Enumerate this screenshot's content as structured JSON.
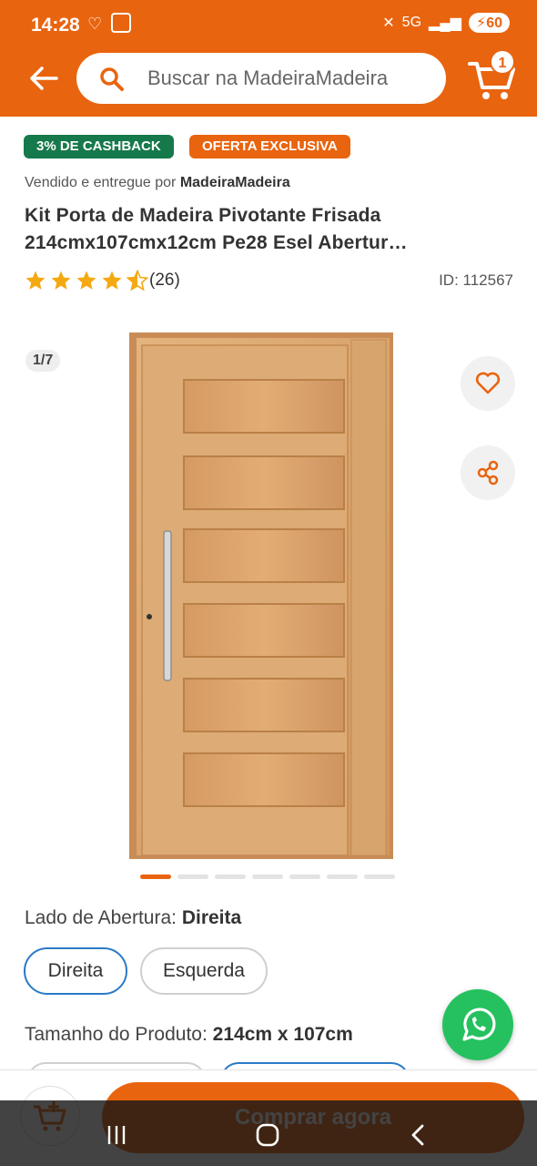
{
  "status_bar": {
    "time": "14:28",
    "network": "5G",
    "battery": "60"
  },
  "header": {
    "search_placeholder": "Buscar na MadeiraMadeira",
    "cart_count": "1"
  },
  "badges": {
    "cashback": "3% DE CASHBACK",
    "offer": "OFERTA EXCLUSIVA"
  },
  "product": {
    "seller_prefix": "Vendido e entregue por",
    "seller_name": "MadeiraMadeira",
    "title": "Kit Porta de Madeira Pivotante Frisada 214cmx107cmx12cm Pe28 Esel Abertur…",
    "rating": 4.5,
    "reviews": "(26)",
    "id": "ID: 112567"
  },
  "gallery": {
    "counter": "1/7",
    "total_images": 7,
    "current_image": 1
  },
  "options": {
    "lado_label": "Lado de Abertura:",
    "lado_value": "Direita",
    "lado_choices": [
      "Direita",
      "Esquerda"
    ],
    "lado_selected": "Direita",
    "tamanho_label": "Tamanho do Produto:",
    "tamanho_value": "214cm x 107cm"
  },
  "actions": {
    "buy_label": "Comprar agora"
  },
  "colors": {
    "brand": "#e9640f",
    "cashback_badge": "#16794b",
    "selected_chip": "#2a7ac7",
    "whatsapp": "#25c15f"
  }
}
